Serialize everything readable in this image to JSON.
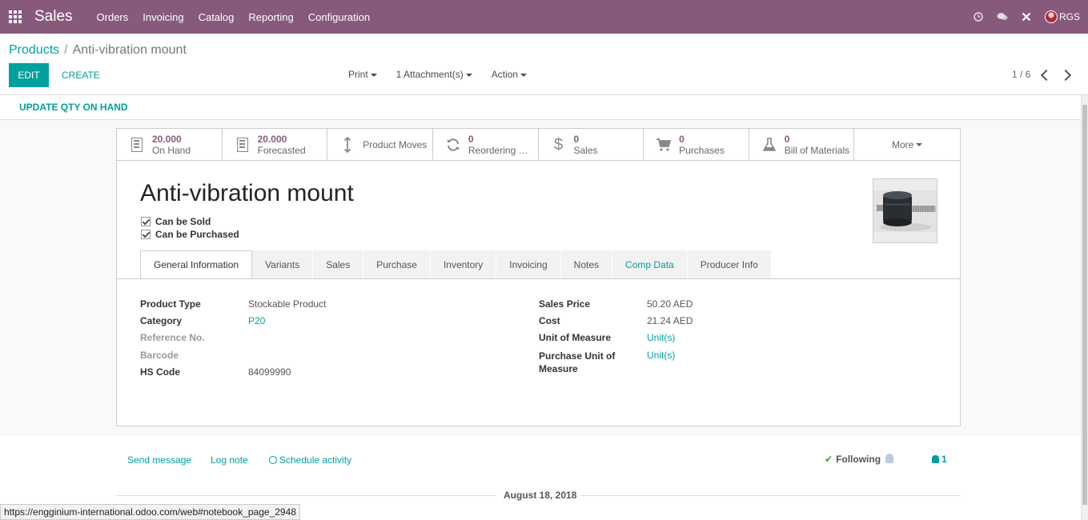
{
  "navbar": {
    "brand": "Sales",
    "menu": [
      "Orders",
      "Invoicing",
      "Catalog",
      "Reporting",
      "Configuration"
    ],
    "user": "RGS",
    "icons": [
      "apps-grid-icon",
      "clock-icon",
      "chat-bubbles-icon",
      "close-x-icon"
    ],
    "bg_color": "#875a7b"
  },
  "breadcrumb": {
    "parent": "Products",
    "separator": "/",
    "current": "Anti-vibration mount"
  },
  "control": {
    "edit_label": "EDIT",
    "create_label": "CREATE",
    "print_label": "Print",
    "attachments_label": "1 Attachment(s)",
    "action_label": "Action",
    "pager": "1 / 6"
  },
  "statusbar": {
    "update_qty_label": "UPDATE QTY ON HAND"
  },
  "smart_buttons": [
    {
      "value": "20.000",
      "label": "On Hand",
      "icon": "building-icon"
    },
    {
      "value": "20.000",
      "label": "Forecasted",
      "icon": "building-icon"
    },
    {
      "value": "",
      "label": "Product Moves",
      "icon": "up-down-arrow-icon"
    },
    {
      "value": "0",
      "label": "Reordering R...",
      "icon": "refresh-icon"
    },
    {
      "value": "0",
      "label": "Sales",
      "icon": "dollar-icon"
    },
    {
      "value": "0",
      "label": "Purchases",
      "icon": "cart-icon"
    },
    {
      "value": "0",
      "label": "Bill of Materials",
      "icon": "flask-icon"
    },
    {
      "value": "",
      "label": "More",
      "icon": "caret-down-icon"
    }
  ],
  "product": {
    "name": "Anti-vibration mount",
    "can_be_sold": "Can be Sold",
    "can_be_purchased": "Can be Purchased"
  },
  "tabs": [
    "General Information",
    "Variants",
    "Sales",
    "Purchase",
    "Inventory",
    "Invoicing",
    "Notes",
    "Comp Data",
    "Producer Info"
  ],
  "general": {
    "left": [
      {
        "label": "Product Type",
        "value": "Stockable Product"
      },
      {
        "label": "Category",
        "value": "P20"
      },
      {
        "label": "Reference No.",
        "value": ""
      },
      {
        "label": "Barcode",
        "value": ""
      },
      {
        "label": "HS Code",
        "value": "84099990"
      }
    ],
    "right": [
      {
        "label": "Sales Price",
        "value": "50.20 AED"
      },
      {
        "label": "Cost",
        "value": "21.24 AED"
      },
      {
        "label": "Unit of Measure",
        "value": "Unit(s)"
      },
      {
        "label": "Purchase Unit of Measure",
        "value": "Unit(s)"
      }
    ]
  },
  "chatter": {
    "send_message": "Send message",
    "log_note": "Log note",
    "schedule_activity": "Schedule activity",
    "following": "Following",
    "followers_count": "1",
    "date_separator": "August 18, 2018"
  },
  "status_url": "https://engginium-international.odoo.com/web#notebook_page_2948"
}
